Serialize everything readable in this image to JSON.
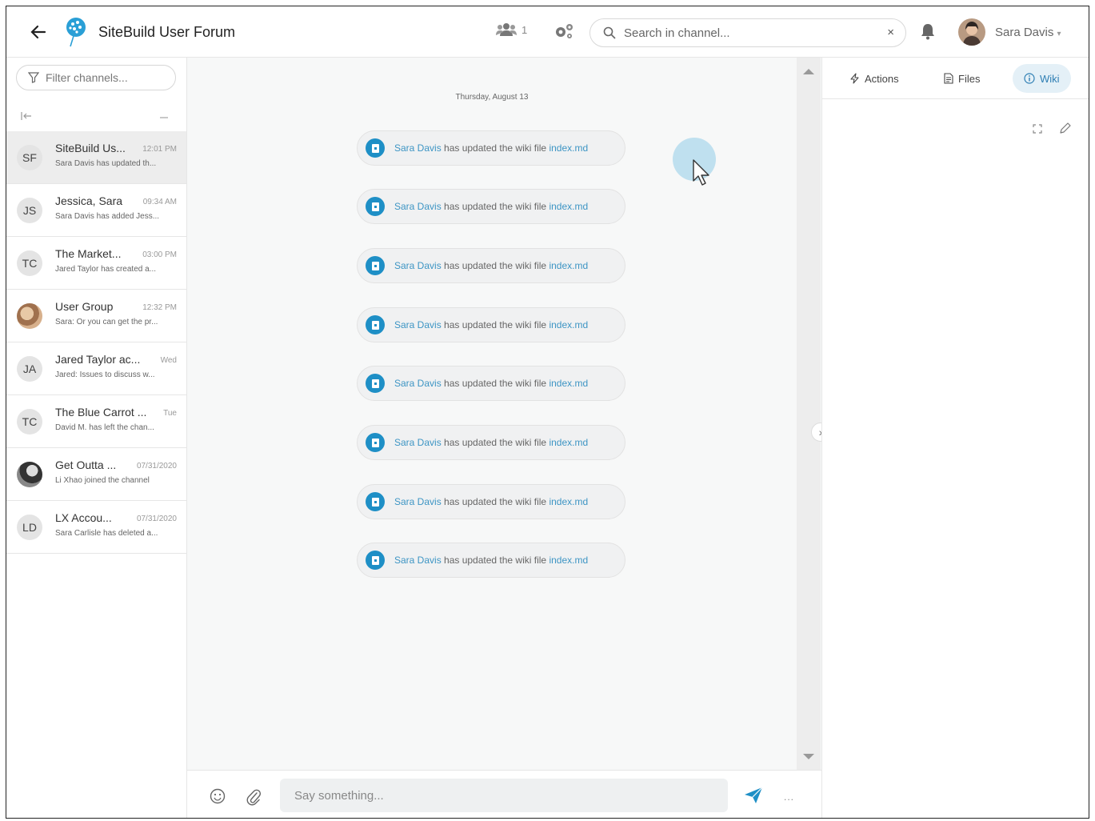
{
  "header": {
    "title": "SiteBuild User Forum",
    "member_count": "1",
    "search_placeholder": "Search in channel...",
    "search_clear": "×",
    "user_name": "Sara Davis",
    "user_caret": "▾"
  },
  "sidebar": {
    "filter_placeholder": "Filter channels...",
    "channels": [
      {
        "initials": "SF",
        "name": "SiteBuild Us...",
        "time": "12:01 PM",
        "preview": "Sara Davis has updated th..."
      },
      {
        "initials": "JS",
        "name": "Jessica, Sara",
        "time": "09:34 AM",
        "preview": "Sara Davis has added Jess..."
      },
      {
        "initials": "TC",
        "name": "The Market...",
        "time": "03:00 PM",
        "preview": "Jared Taylor has created a..."
      },
      {
        "initials": "",
        "name": "User Group",
        "time": "12:32 PM",
        "preview": "Sara: Or you can get the pr..."
      },
      {
        "initials": "JA",
        "name": "Jared Taylor ac...",
        "time": "Wed",
        "preview": "Jared: Issues to discuss w..."
      },
      {
        "initials": "TC",
        "name": "The Blue Carrot ...",
        "time": "Tue",
        "preview": "David M. has left the chan..."
      },
      {
        "initials": "",
        "name": "Get Outta ...",
        "time": "07/31/2020",
        "preview": "Li Xhao joined the channel"
      },
      {
        "initials": "LD",
        "name": "LX Accou...",
        "time": "07/31/2020",
        "preview": "Sara Carlisle has deleted a..."
      }
    ]
  },
  "chat": {
    "date": "Thursday, August 13",
    "messages": [
      {
        "user": "Sara Davis",
        "action": " has updated the wiki file ",
        "file": "index.md"
      },
      {
        "user": "Sara Davis",
        "action": " has updated the wiki file ",
        "file": "index.md"
      },
      {
        "user": "Sara Davis",
        "action": " has updated the wiki file ",
        "file": "index.md"
      },
      {
        "user": "Sara Davis",
        "action": " has updated the wiki file ",
        "file": "index.md"
      },
      {
        "user": "Sara Davis",
        "action": " has updated the wiki file ",
        "file": "index.md"
      },
      {
        "user": "Sara Davis",
        "action": " has updated the wiki file ",
        "file": "index.md"
      },
      {
        "user": "Sara Davis",
        "action": " has updated the wiki file ",
        "file": "index.md"
      },
      {
        "user": "Sara Davis",
        "action": " has updated the wiki file ",
        "file": "index.md"
      }
    ],
    "composer_placeholder": "Say something...",
    "more": "...",
    "toggle": "›"
  },
  "right_panel": {
    "tabs": [
      {
        "label": "Actions",
        "active": false
      },
      {
        "label": "Files",
        "active": false
      },
      {
        "label": "Wiki",
        "active": true
      }
    ]
  },
  "colors": {
    "accent": "#1e8fc6",
    "link": "#3d95c4",
    "active_tab_bg": "#e4f0f7"
  }
}
